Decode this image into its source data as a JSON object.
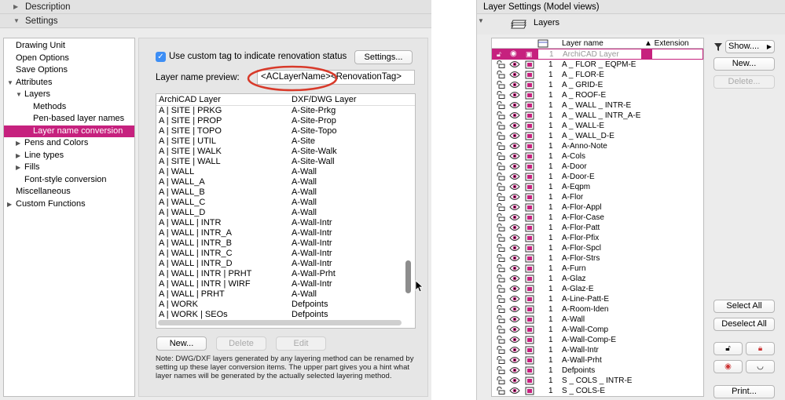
{
  "left_window": {
    "sections": {
      "description": "Description",
      "settings": "Settings"
    },
    "tree": [
      {
        "label": "Drawing Unit",
        "level": 0,
        "toggle": ""
      },
      {
        "label": "Open Options",
        "level": 0,
        "toggle": ""
      },
      {
        "label": "Save Options",
        "level": 0,
        "toggle": ""
      },
      {
        "label": "Attributes",
        "level": 0,
        "toggle": "▼"
      },
      {
        "label": "Layers",
        "level": 1,
        "toggle": "▼"
      },
      {
        "label": "Methods",
        "level": 2,
        "toggle": ""
      },
      {
        "label": "Pen-based layer names",
        "level": 2,
        "toggle": ""
      },
      {
        "label": "Layer name conversion",
        "level": 2,
        "toggle": "",
        "selected": true
      },
      {
        "label": "Pens and Colors",
        "level": 1,
        "toggle": "▶"
      },
      {
        "label": "Line types",
        "level": 1,
        "toggle": "▶"
      },
      {
        "label": "Fills",
        "level": 1,
        "toggle": "▶"
      },
      {
        "label": "Font-style conversion",
        "level": 1,
        "toggle": ""
      },
      {
        "label": "Miscellaneous",
        "level": 0,
        "toggle": ""
      },
      {
        "label": "Custom Functions",
        "level": 0,
        "toggle": "▶"
      }
    ],
    "panel": {
      "checkbox_label": "Use custom tag to indicate renovation status",
      "settings_button": "Settings...",
      "preview_label": "Layer name preview:",
      "preview_value": "<ACLayerName><RenovationTag>",
      "col_archicad": "ArchiCAD Layer",
      "col_dxf": "DXF/DWG Layer",
      "rows": [
        [
          "A | SITE | PRKG",
          "A-Site-Prkg"
        ],
        [
          "A | SITE | PROP",
          "A-Site-Prop"
        ],
        [
          "A | SITE | TOPO",
          "A-Site-Topo"
        ],
        [
          "A | SITE | UTIL",
          "A-Site"
        ],
        [
          "A | SITE | WALK",
          "A-Site-Walk"
        ],
        [
          "A | SITE | WALL",
          "A-Site-Wall"
        ],
        [
          "A | WALL",
          "A-Wall"
        ],
        [
          "A | WALL_A",
          "A-Wall"
        ],
        [
          "A | WALL_B",
          "A-Wall"
        ],
        [
          "A | WALL_C",
          "A-Wall"
        ],
        [
          "A | WALL_D",
          "A-Wall"
        ],
        [
          "A | WALL | INTR",
          "A-Wall-Intr"
        ],
        [
          "A | WALL | INTR_A",
          "A-Wall-Intr"
        ],
        [
          "A | WALL | INTR_B",
          "A-Wall-Intr"
        ],
        [
          "A | WALL | INTR_C",
          "A-Wall-Intr"
        ],
        [
          "A | WALL | INTR_D",
          "A-Wall-Intr"
        ],
        [
          "A | WALL | INTR | PRHT",
          "A-Wall-Prht"
        ],
        [
          "A | WALL | INTR | WIRF",
          "A-Wall-Intr"
        ],
        [
          "A | WALL | PRHT",
          "A-Wall"
        ],
        [
          "A | WORK",
          "Defpoints"
        ],
        [
          "A | WORK | SEOs",
          "Defpoints"
        ]
      ],
      "new_button": "New...",
      "delete_button": "Delete",
      "edit_button": "Edit",
      "note": "Note: DWG/DXF layers generated by any layering method can be renamed by setting up these layer conversion items. The upper part gives you a hint what layer names will be generated by the actually selected layering method."
    },
    "accent_color": "#c6217e",
    "highlight_color": "#d83a2a"
  },
  "right_window": {
    "title": "Layer Settings (Model views)",
    "section": "Layers",
    "col_name": "Layer name",
    "col_ext": "▲ Extension",
    "first_row": {
      "name": "ArchiCAD Layer",
      "num": "1"
    },
    "layers": [
      "A _ FLOR _ EQPM-E",
      "A _ FLOR-E",
      "A _ GRID-E",
      "A _ ROOF-E",
      "A _ WALL _ INTR-E",
      "A _ WALL _ INTR_A-E",
      "A _ WALL-E",
      "A _ WALL_D-E",
      "A-Anno-Note",
      "A-Cols",
      "A-Door",
      "A-Door-E",
      "A-Eqpm",
      "A-Flor",
      "A-Flor-Appl",
      "A-Flor-Case",
      "A-Flor-Patt",
      "A-Flor-Pfix",
      "A-Flor-Spcl",
      "A-Flor-Strs",
      "A-Furn",
      "A-Glaz",
      "A-Glaz-E",
      "A-Line-Patt-E",
      "A-Room-Iden",
      "A-Wall",
      "A-Wall-Comp",
      "A-Wall-Comp-E",
      "A-Wall-Intr",
      "A-Wall-Prht",
      "Defpoints",
      "S _ COLS _ INTR-E",
      "S _ COLS-E"
    ],
    "layer_num": "1",
    "buttons": {
      "show": "Show....",
      "new": "New...",
      "delete": "Delete...",
      "select_all": "Select All",
      "deselect_all": "Deselect All",
      "print": "Print..."
    }
  }
}
